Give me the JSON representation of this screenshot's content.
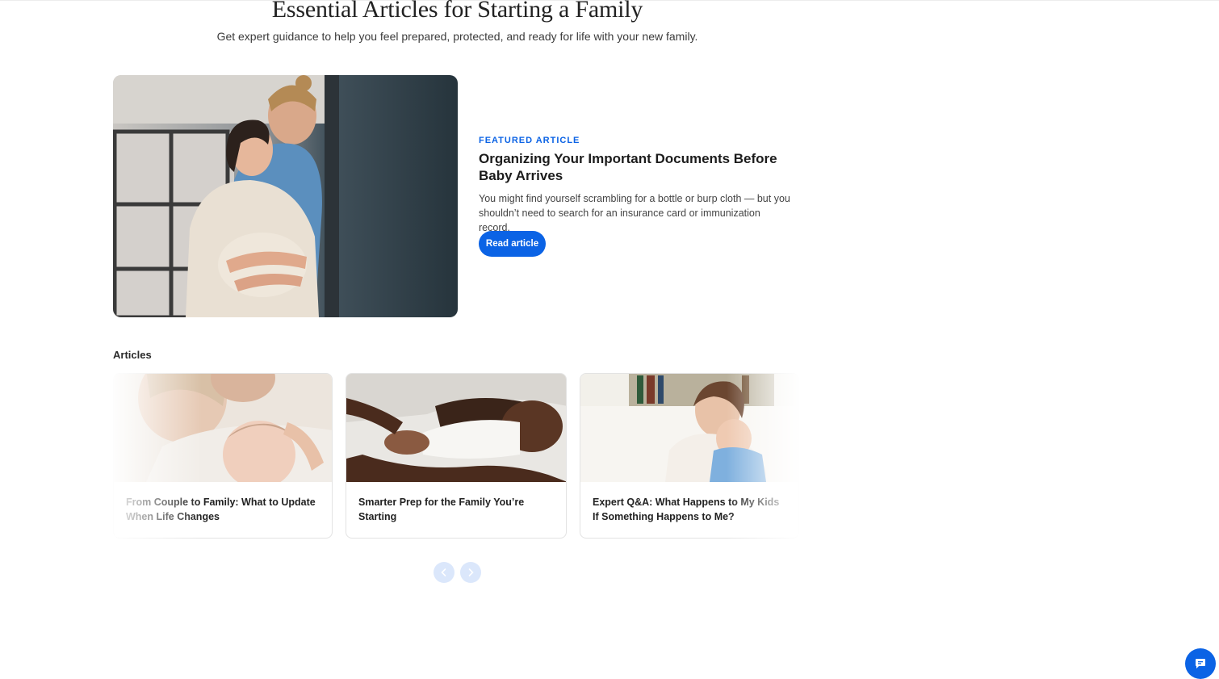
{
  "page": {
    "title": "Essential Articles for Starting a Family",
    "subtitle": "Get expert guidance to help you feel prepared, protected, and ready for life with your new family."
  },
  "featured": {
    "eyebrow": "FEATURED ARTICLE",
    "title": "Organizing Your Important Documents Before Baby Arrives",
    "description": "You might find yourself scrambling for a bottle or burp cloth — but you shouldn’t need to search for an insurance card or immunization record.",
    "button_label": "Read article"
  },
  "articles": {
    "label": "Articles",
    "items": [
      {
        "title": "From Couple to Family: What to Update When Life Changes"
      },
      {
        "title": "Smarter Prep for the Family You’re Starting"
      },
      {
        "title": "Expert Q&A: What Happens to My Kids If Something Happens to Me?"
      }
    ]
  },
  "carousel": {
    "prev_icon": "chevron-left-icon",
    "next_icon": "chevron-right-icon"
  },
  "chat": {
    "icon": "chat-bubble-icon"
  },
  "colors": {
    "accent": "#0b63e5",
    "carousel_button": "#dbe7fb"
  }
}
